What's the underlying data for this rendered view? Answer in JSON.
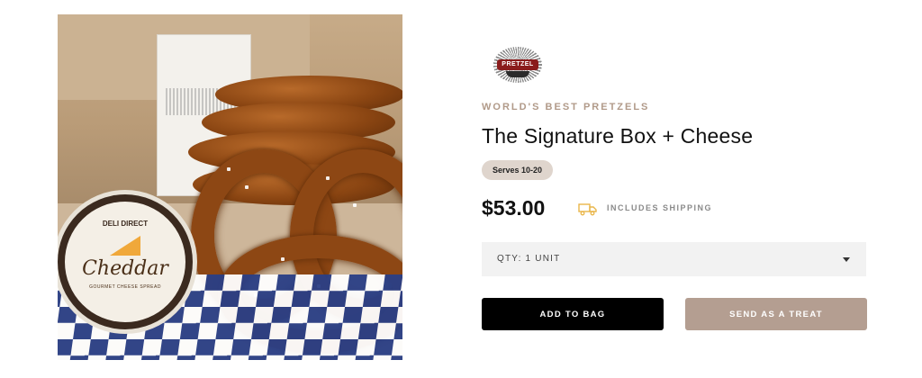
{
  "product_image": {
    "tub_brand": "DELI DIRECT",
    "tub_flavor": "Cheddar",
    "tub_subtitle": "GOURMET CHEESE SPREAD"
  },
  "brand_logo": {
    "text": "PRETZEL"
  },
  "product": {
    "eyebrow": "WORLD'S BEST PRETZELS",
    "title": "The Signature Box + Cheese",
    "badge": "Serves 10-20",
    "price": "$53.00",
    "shipping_note": "INCLUDES SHIPPING"
  },
  "quantity_select": {
    "value": "QTY: 1 UNIT"
  },
  "actions": {
    "add_to_bag": "ADD TO BAG",
    "send_as_treat": "SEND AS A TREAT"
  },
  "colors": {
    "accent": "#b19a89",
    "badge_bg": "#dfd5cd",
    "treat_button": "#b49e91",
    "primary_button": "#000000",
    "shipping_icon": "#e9b64a"
  },
  "icons": {
    "shipping": "truck-icon",
    "dropdown": "chevron-down-icon"
  }
}
